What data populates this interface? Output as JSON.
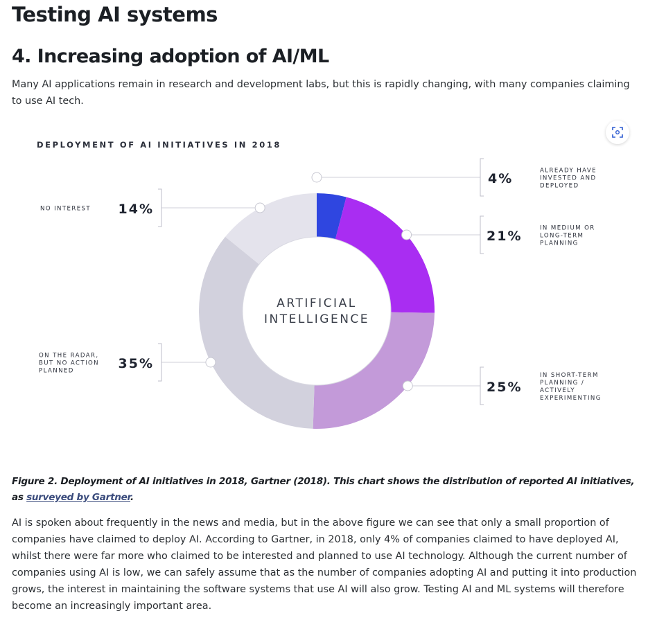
{
  "page": {
    "title": "Testing AI systems",
    "section_title": "4. Increasing adoption of AI/ML",
    "intro": "Many AI applications remain in research and development labs, but this is rapidly changing, with many companies claiming to use AI tech."
  },
  "chart_data": {
    "type": "pie",
    "title": "DEPLOYMENT OF AI INITIATIVES IN 2018",
    "center_label": [
      "ARTIFICIAL",
      "INTELLIGENCE"
    ],
    "slices": [
      {
        "value": 4,
        "label_value": "4%",
        "label": [
          "ALREADY HAVE",
          "INVESTED AND",
          "DEPLOYED"
        ],
        "color": "#2f46e0"
      },
      {
        "value": 21,
        "label_value": "21%",
        "label": [
          "IN MEDIUM OR",
          "LONG-TERM",
          "PLANNING"
        ],
        "color": "#a92df2"
      },
      {
        "value": 25,
        "label_value": "25%",
        "label": [
          "IN SHORT-TERM",
          "PLANNING /",
          "ACTIVELY",
          "EXPERIMENTING"
        ],
        "color": "#c39ad9"
      },
      {
        "value": 35,
        "label_value": "35%",
        "label": [
          "ON THE RADAR,",
          "BUT NO ACTION",
          "PLANNED"
        ],
        "color": "#d2d1dd"
      },
      {
        "value": 14,
        "label_value": "14%",
        "label": [
          "NO INTEREST"
        ],
        "color": "#e4e3ec"
      }
    ]
  },
  "figure": {
    "caption_text": "Figure 2. Deployment of AI initiatives in 2018, Gartner (2018). This chart shows the distribution of reported AI initiatives, as ",
    "caption_link": "surveyed by Gartner",
    "caption_end": "."
  },
  "body": {
    "paragraph": "AI is spoken about frequently in the news and media, but in the above figure we can see that only a small proportion of companies have claimed to deploy AI. According to Gartner, in 2018, only 4% of companies claimed to have deployed AI, whilst there were far more who claimed to be interested and planned to use AI technology. Although the current number of companies using AI is low, we can safely assume that as the number of companies adopting AI and putting it into production grows, the interest in maintaining the software systems that use AI will also grow. Testing AI and ML systems will therefore become an increasingly important area."
  },
  "icons": {
    "expand": "expand-icon"
  }
}
